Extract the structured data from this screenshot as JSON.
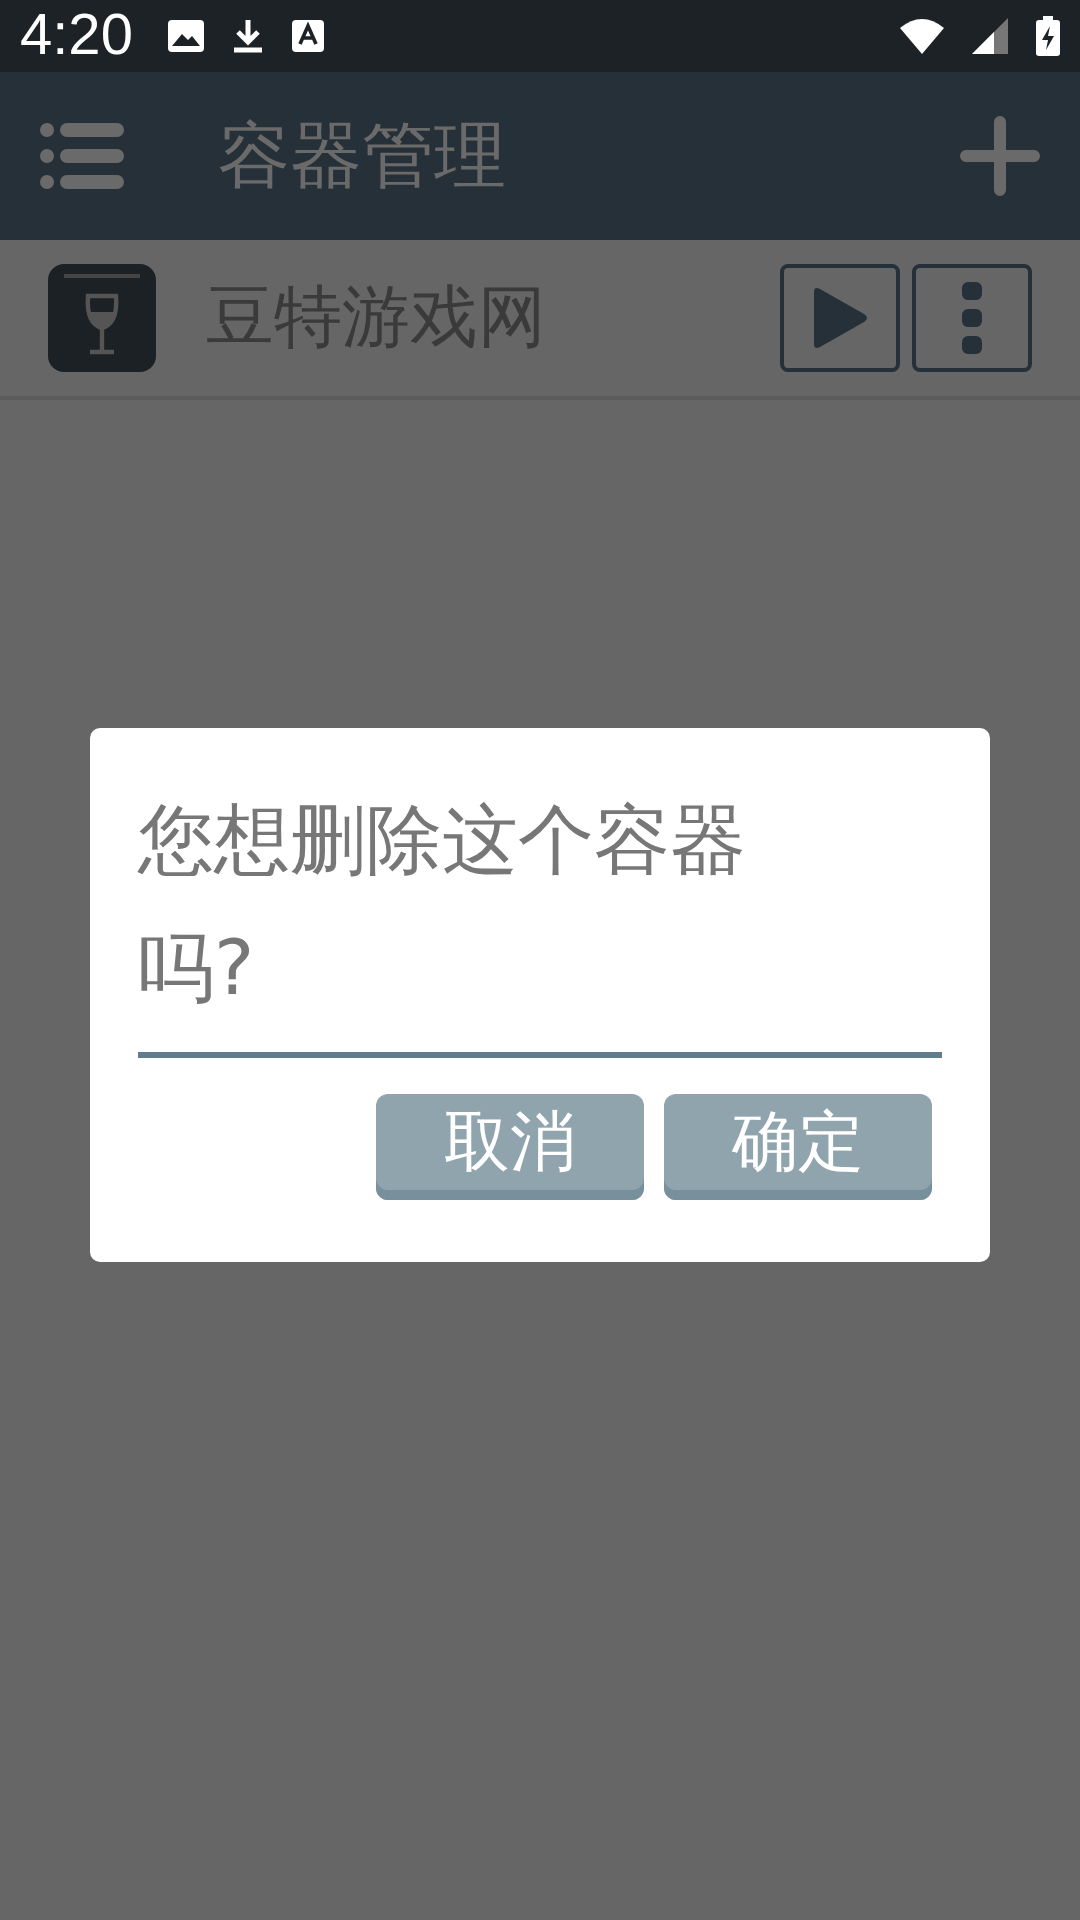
{
  "status_bar": {
    "time": "4:20"
  },
  "app_bar": {
    "title": "容器管理"
  },
  "containers": [
    {
      "name": "豆特游戏网"
    }
  ],
  "dialog": {
    "message": "您想删除这个容器吗?",
    "buttons": [
      {
        "label": "取消"
      },
      {
        "label": "确定"
      }
    ]
  }
}
